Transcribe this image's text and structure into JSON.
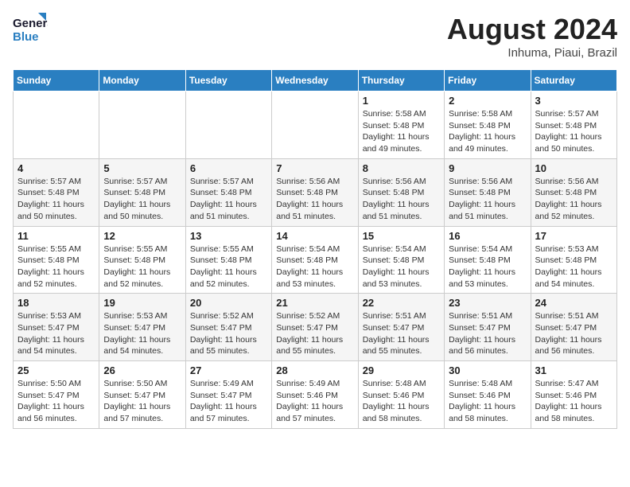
{
  "header": {
    "logo_line1": "General",
    "logo_line2": "Blue",
    "month_title": "August 2024",
    "location": "Inhuma, Piaui, Brazil"
  },
  "calendar": {
    "days_of_week": [
      "Sunday",
      "Monday",
      "Tuesday",
      "Wednesday",
      "Thursday",
      "Friday",
      "Saturday"
    ],
    "weeks": [
      [
        {
          "day": "",
          "info": ""
        },
        {
          "day": "",
          "info": ""
        },
        {
          "day": "",
          "info": ""
        },
        {
          "day": "",
          "info": ""
        },
        {
          "day": "1",
          "info": "Sunrise: 5:58 AM\nSunset: 5:48 PM\nDaylight: 11 hours\nand 49 minutes."
        },
        {
          "day": "2",
          "info": "Sunrise: 5:58 AM\nSunset: 5:48 PM\nDaylight: 11 hours\nand 49 minutes."
        },
        {
          "day": "3",
          "info": "Sunrise: 5:57 AM\nSunset: 5:48 PM\nDaylight: 11 hours\nand 50 minutes."
        }
      ],
      [
        {
          "day": "4",
          "info": "Sunrise: 5:57 AM\nSunset: 5:48 PM\nDaylight: 11 hours\nand 50 minutes."
        },
        {
          "day": "5",
          "info": "Sunrise: 5:57 AM\nSunset: 5:48 PM\nDaylight: 11 hours\nand 50 minutes."
        },
        {
          "day": "6",
          "info": "Sunrise: 5:57 AM\nSunset: 5:48 PM\nDaylight: 11 hours\nand 51 minutes."
        },
        {
          "day": "7",
          "info": "Sunrise: 5:56 AM\nSunset: 5:48 PM\nDaylight: 11 hours\nand 51 minutes."
        },
        {
          "day": "8",
          "info": "Sunrise: 5:56 AM\nSunset: 5:48 PM\nDaylight: 11 hours\nand 51 minutes."
        },
        {
          "day": "9",
          "info": "Sunrise: 5:56 AM\nSunset: 5:48 PM\nDaylight: 11 hours\nand 51 minutes."
        },
        {
          "day": "10",
          "info": "Sunrise: 5:56 AM\nSunset: 5:48 PM\nDaylight: 11 hours\nand 52 minutes."
        }
      ],
      [
        {
          "day": "11",
          "info": "Sunrise: 5:55 AM\nSunset: 5:48 PM\nDaylight: 11 hours\nand 52 minutes."
        },
        {
          "day": "12",
          "info": "Sunrise: 5:55 AM\nSunset: 5:48 PM\nDaylight: 11 hours\nand 52 minutes."
        },
        {
          "day": "13",
          "info": "Sunrise: 5:55 AM\nSunset: 5:48 PM\nDaylight: 11 hours\nand 52 minutes."
        },
        {
          "day": "14",
          "info": "Sunrise: 5:54 AM\nSunset: 5:48 PM\nDaylight: 11 hours\nand 53 minutes."
        },
        {
          "day": "15",
          "info": "Sunrise: 5:54 AM\nSunset: 5:48 PM\nDaylight: 11 hours\nand 53 minutes."
        },
        {
          "day": "16",
          "info": "Sunrise: 5:54 AM\nSunset: 5:48 PM\nDaylight: 11 hours\nand 53 minutes."
        },
        {
          "day": "17",
          "info": "Sunrise: 5:53 AM\nSunset: 5:48 PM\nDaylight: 11 hours\nand 54 minutes."
        }
      ],
      [
        {
          "day": "18",
          "info": "Sunrise: 5:53 AM\nSunset: 5:47 PM\nDaylight: 11 hours\nand 54 minutes."
        },
        {
          "day": "19",
          "info": "Sunrise: 5:53 AM\nSunset: 5:47 PM\nDaylight: 11 hours\nand 54 minutes."
        },
        {
          "day": "20",
          "info": "Sunrise: 5:52 AM\nSunset: 5:47 PM\nDaylight: 11 hours\nand 55 minutes."
        },
        {
          "day": "21",
          "info": "Sunrise: 5:52 AM\nSunset: 5:47 PM\nDaylight: 11 hours\nand 55 minutes."
        },
        {
          "day": "22",
          "info": "Sunrise: 5:51 AM\nSunset: 5:47 PM\nDaylight: 11 hours\nand 55 minutes."
        },
        {
          "day": "23",
          "info": "Sunrise: 5:51 AM\nSunset: 5:47 PM\nDaylight: 11 hours\nand 56 minutes."
        },
        {
          "day": "24",
          "info": "Sunrise: 5:51 AM\nSunset: 5:47 PM\nDaylight: 11 hours\nand 56 minutes."
        }
      ],
      [
        {
          "day": "25",
          "info": "Sunrise: 5:50 AM\nSunset: 5:47 PM\nDaylight: 11 hours\nand 56 minutes."
        },
        {
          "day": "26",
          "info": "Sunrise: 5:50 AM\nSunset: 5:47 PM\nDaylight: 11 hours\nand 57 minutes."
        },
        {
          "day": "27",
          "info": "Sunrise: 5:49 AM\nSunset: 5:47 PM\nDaylight: 11 hours\nand 57 minutes."
        },
        {
          "day": "28",
          "info": "Sunrise: 5:49 AM\nSunset: 5:46 PM\nDaylight: 11 hours\nand 57 minutes."
        },
        {
          "day": "29",
          "info": "Sunrise: 5:48 AM\nSunset: 5:46 PM\nDaylight: 11 hours\nand 58 minutes."
        },
        {
          "day": "30",
          "info": "Sunrise: 5:48 AM\nSunset: 5:46 PM\nDaylight: 11 hours\nand 58 minutes."
        },
        {
          "day": "31",
          "info": "Sunrise: 5:47 AM\nSunset: 5:46 PM\nDaylight: 11 hours\nand 58 minutes."
        }
      ]
    ]
  }
}
